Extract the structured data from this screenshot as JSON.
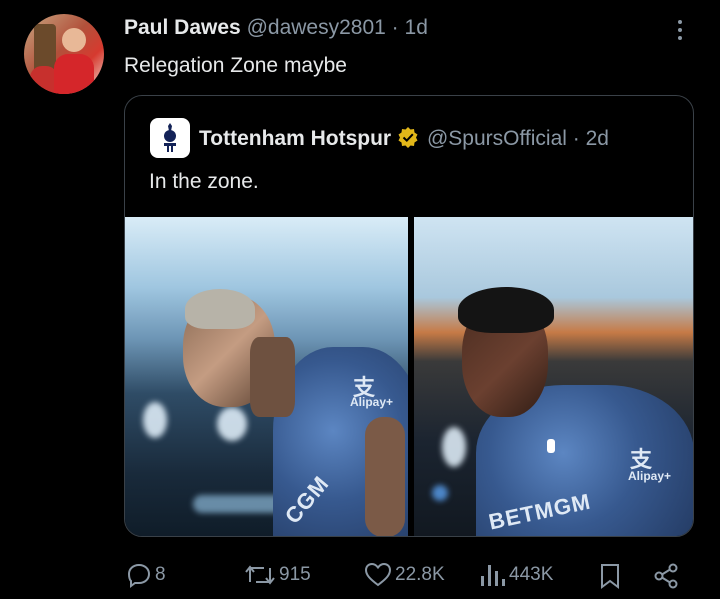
{
  "tweet": {
    "author_name": "Paul Dawes",
    "author_handle": "@dawesy2801",
    "time_sep": "·",
    "time": "1d",
    "text": "Relegation Zone maybe"
  },
  "quoted": {
    "author_name": "Tottenham Hotspur",
    "author_handle": "@SpursOfficial",
    "time_sep": "·",
    "time": "2d",
    "text": "In the zone.",
    "photo_left": {
      "kit_sponsor": "CGM",
      "kit_small": "Alipay+",
      "kit_logo": "支"
    },
    "photo_right": {
      "kit_sponsor": "BETMGM",
      "kit_small": "Alipay+",
      "kit_logo": "支"
    }
  },
  "actions": {
    "replies": "8",
    "reposts": "915",
    "likes": "22.8K",
    "views": "443K"
  },
  "icons": [
    "more-icon",
    "verified-icon",
    "reply-icon",
    "repost-icon",
    "like-icon",
    "views-icon",
    "bookmark-icon",
    "share-icon"
  ],
  "colors": {
    "background": "#000000",
    "text": "#e7e9ea",
    "muted": "#8b98a5",
    "verified": "#e2b719"
  }
}
